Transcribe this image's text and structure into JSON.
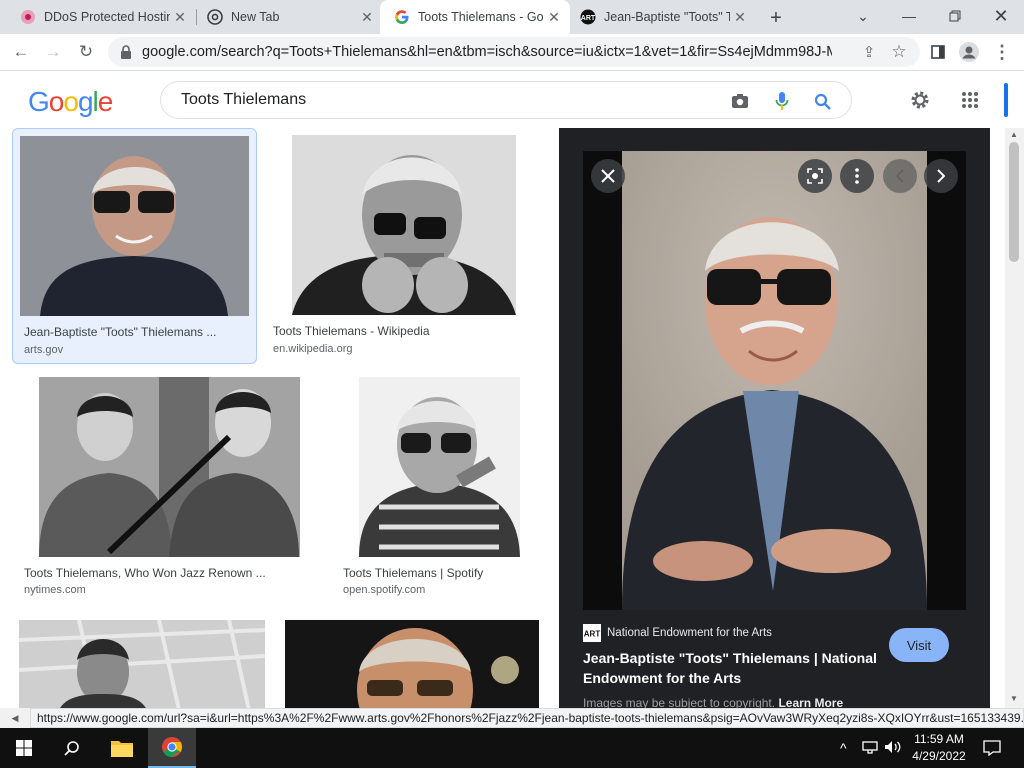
{
  "browser": {
    "tabs": [
      {
        "title": "DDoS Protected Hostin",
        "active": false
      },
      {
        "title": "New Tab",
        "active": false
      },
      {
        "title": "Toots Thielemans - Go",
        "active": true
      },
      {
        "title": "Jean-Baptiste \"Toots\" T",
        "active": false
      }
    ],
    "url": "google.com/search?q=Toots+Thielemans&hl=en&tbm=isch&source=iu&ictx=1&vet=1&fir=Ss4ejMdmm98J-M..."
  },
  "google": {
    "logo": [
      "G",
      "o",
      "o",
      "g",
      "l",
      "e"
    ],
    "query": "Toots Thielemans"
  },
  "results": [
    {
      "caption": "Jean-Baptiste \"Toots\" Thielemans ...",
      "source": "arts.gov",
      "selected": true
    },
    {
      "caption": "Toots Thielemans - Wikipedia",
      "source": "en.wikipedia.org",
      "selected": false
    },
    {
      "caption": "Toots Thielemans, Who Won Jazz Renown ...",
      "source": "nytimes.com",
      "selected": false
    },
    {
      "caption": "Toots Thielemans | Spotify",
      "source": "open.spotify.com",
      "selected": false
    }
  ],
  "preview": {
    "source_name": "National Endowment for the Arts",
    "title": "Jean-Baptiste \"Toots\" Thielemans | National Endowment for the Arts",
    "visit_label": "Visit",
    "note": "Images may be subject to copyright.",
    "learn_more": "Learn More"
  },
  "status_url": "https://www.google.com/url?sa=i&url=https%3A%2F%2Fwww.arts.gov%2Fhonors%2Fjazz%2Fjean-baptiste-toots-thielemans&psig=AOvVaw3WRyXeq2yzi8s-XQxIOYrr&ust=165133439...",
  "taskbar": {
    "time": "11:59 AM",
    "date": "4/29/2022"
  },
  "colors": {
    "google_blue": "#4285f4",
    "google_red": "#ea4335",
    "google_yellow": "#fbbc05",
    "google_green": "#34a853",
    "panel_bg": "#202124",
    "visit_bg": "#8ab4f8"
  }
}
